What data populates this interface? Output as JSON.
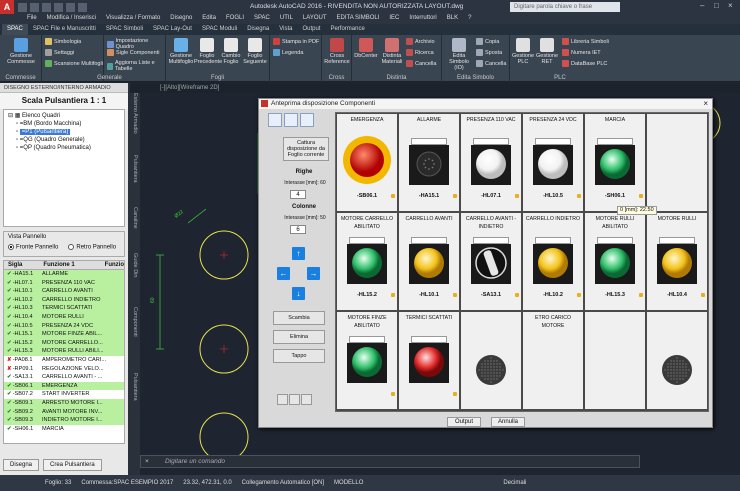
{
  "titlebar": {
    "logo": "A",
    "title": "Autodesk AutoCAD 2016 - RIVENDITA NON AUTORIZZATA   LAYOUT.dwg",
    "search": "Digitare parola chiave o frase"
  },
  "menu": [
    "File",
    "Modifica / Inserisci",
    "Visualizza / Formato",
    "Disegno",
    "Edita",
    "FOGLI",
    "SPAC",
    "UTIL",
    "LAYOUT",
    "EDITA SIMBOLI",
    "IEC",
    "Interruttori",
    "BLK",
    "?"
  ],
  "tabs": [
    "SPAC",
    "SPAC File e Manuscritti",
    "SPAC Simboli",
    "SPAC Lay-Out",
    "SPAC Moduli",
    "Disegna",
    "Vista",
    "Output",
    "Performance"
  ],
  "ribbon": {
    "groups": [
      "Commesse",
      "Generale",
      "Fogli",
      "Cross",
      "Distinta",
      "Edita Simbolo",
      "PLC"
    ],
    "buttons": {
      "gestione": "Gestione Commesse",
      "simbologia": "Simbologia",
      "settaggi": "Settaggi",
      "scansione": "Scansione Multifogli",
      "impostazione": "Impostazione Quadro",
      "sigle": "Sigle Componenti",
      "aggiorna": "Aggiorna Liste e Tabelle",
      "gestione_multi": "Gestione Multifoglio",
      "foglio_prec": "Foglio Precedente",
      "cambio": "Cambio Foglio",
      "foglio_succ": "Foglio Seguente",
      "stampa": "Stampa in PDF",
      "legenda": "Legenda",
      "cross": "Cross Reference",
      "dbcenter": "DbCenter",
      "distinta": "Distinta Materiali",
      "archivio": "Archivio",
      "ricerca": "Ricerca",
      "cancella_d": "Cancella",
      "edita_simbolo": "Edita Simbolo (IO)",
      "copia": "Copia",
      "sposta": "Sposta",
      "cancella": "Cancella",
      "gestione_plc": "Gestione PLC",
      "gestione_ret": "Gestione RET",
      "libreria": "Libreria Simboli",
      "numera": "Numera IET",
      "database": "DataBase PLC"
    }
  },
  "docbar": "[-][Alto][Wireframe 2D]",
  "leftpanel": {
    "header": "DISEGNO ESTERNO/INTERNO ARMADIO",
    "scale": "Scala Pulsantiera 1 : 1",
    "tree": [
      "Elenco Quadri",
      "=BM (Bordo Macchina)",
      "=P1 (Pulsantiera)",
      "=QG (Quadro Generale)",
      "=QP (Quadro Pneumatica)"
    ],
    "view_title": "Vista Pannello",
    "view_options": [
      "Fronte Pannello",
      "Retro Pannello"
    ],
    "list_headers": [
      "Sigla",
      "Funzione 1",
      "Funzio"
    ],
    "rows": [
      {
        "sigla": "-HA15.1",
        "funzione": "ALLARME",
        "ok": true,
        "green": true
      },
      {
        "sigla": "-HL07.1",
        "funzione": "PRESENZA 110 VAC",
        "ok": true,
        "green": true
      },
      {
        "sigla": "-HL10.1",
        "funzione": "CARRELLO AVANTI",
        "ok": true,
        "green": true
      },
      {
        "sigla": "-HL10.2",
        "funzione": "CARRELLO INDIETRO",
        "ok": true,
        "green": true
      },
      {
        "sigla": "-HL10.3",
        "funzione": "TERMICI SCATTATI",
        "ok": true,
        "green": true
      },
      {
        "sigla": "-HL10.4",
        "funzione": "MOTORE RULLI",
        "ok": true,
        "green": true
      },
      {
        "sigla": "-HL10.5",
        "funzione": "PRESENZA 24 VDC",
        "ok": true,
        "green": true
      },
      {
        "sigla": "-HL15.1",
        "funzione": "MOTORE FINZE ABIL...",
        "ok": true,
        "green": true
      },
      {
        "sigla": "-HL15.2",
        "funzione": "MOTORE CARRELLO...",
        "ok": true,
        "green": true
      },
      {
        "sigla": "-HL15.3",
        "funzione": "MOTORE RULLI ABILI...",
        "ok": true,
        "green": true
      },
      {
        "sigla": "-PA08.1",
        "funzione": "AMPEROMETRO CARI...",
        "ok": false,
        "green": false
      },
      {
        "sigla": "-RP09.1",
        "funzione": "REGOLAZIONE VELO...",
        "ok": false,
        "green": false
      },
      {
        "sigla": "-SA13.1",
        "funzione": "CARRELLO AVANTI - ...",
        "ok": true,
        "green": false
      },
      {
        "sigla": "-SB06.1",
        "funzione": "EMERGENZA",
        "ok": true,
        "green": true
      },
      {
        "sigla": "-SB07.2",
        "funzione": "START INVERTER",
        "ok": true,
        "green": false
      },
      {
        "sigla": "-SB09.1",
        "funzione": "ARRESTO MOTORE I...",
        "ok": true,
        "green": true
      },
      {
        "sigla": "-SB09.2",
        "funzione": "AVANTI MOTORE INV...",
        "ok": true,
        "green": true
      },
      {
        "sigla": "-SB09.3",
        "funzione": "INDIETRO MOTORE I...",
        "ok": true,
        "green": true
      },
      {
        "sigla": "-SH06.1",
        "funzione": "MARCIA",
        "ok": true,
        "green": false
      }
    ],
    "buttons": [
      "Disegna",
      "Crea Pulsantiera"
    ]
  },
  "vtabs": [
    "Esterno Armadio",
    "Pulsantiera",
    "Canaline",
    "Guide Din",
    "Componenti",
    "Pulsantiera"
  ],
  "dialog": {
    "title": "Anteprima disposizione Componenti",
    "cattura": "Cattura disposizione da Foglio corrente",
    "righe": "Righe",
    "righe_int": "Interasse [mm]: 60",
    "righe_val": "4",
    "colonne": "Colonne",
    "colonne_int": "Interasse [mm]: 50",
    "colonne_val": "6",
    "scambia": "Scambia",
    "elimina": "Elimina",
    "tappo": "Tappo",
    "output": "Output",
    "annulla": "Annulla",
    "tooltip": "0 [mm]: 22.50",
    "cells": [
      {
        "title": "EMERGENZA",
        "code": "-SB06.1",
        "kind": "emerg"
      },
      {
        "title": "ALLARME",
        "code": "-HA15.1",
        "kind": "buzzer"
      },
      {
        "title": "PRESENZA 110 VAC",
        "code": "-HL07.1",
        "kind": "white"
      },
      {
        "title": "PRESENZA 24 VDC",
        "code": "-HL10.5",
        "kind": "white"
      },
      {
        "title": "MARCIA",
        "code": "-SH06.1",
        "kind": "green"
      },
      {
        "title": "",
        "code": "",
        "kind": "empty"
      },
      {
        "title": "MOTORE CARRELLO ABILITATO",
        "code": "-HL15.2",
        "kind": "green"
      },
      {
        "title": "CARRELLO AVANTI",
        "code": "-HL10.1",
        "kind": "yellow"
      },
      {
        "title": "CARRELLO AVANTI - INDIETRO",
        "code": "-SA13.1",
        "kind": "selector"
      },
      {
        "title": "CARRELLO INDIETRO",
        "code": "-HL10.2",
        "kind": "yellow"
      },
      {
        "title": "MOTORE RULLI ABILITATO",
        "code": "-HL15.3",
        "kind": "green"
      },
      {
        "title": "MOTORE RULLI",
        "code": "-HL10.4",
        "kind": "yellow"
      },
      {
        "title": "MOTORE FINZE ABILITATO",
        "code": "",
        "kind": "green"
      },
      {
        "title": "TERMICI SCATTATI",
        "code": "",
        "kind": "red"
      },
      {
        "title": "",
        "code": "",
        "kind": "dark"
      },
      {
        "title": "ETRO CARICO MOTORE",
        "code": "",
        "kind": "empty"
      },
      {
        "title": "",
        "code": "",
        "kind": "empty"
      },
      {
        "title": "",
        "code": "",
        "kind": "dark"
      }
    ]
  },
  "cmdline": "Digitare un comando",
  "status": {
    "foglio": "Foglio: 33",
    "commessa": "Commessa:SPAC ESEMPIO 2017",
    "coords": "23.32, 472.31, 0.0",
    "collegamento": "Collegamento Automatico [ON]",
    "modello": "MODELLO",
    "decimali": "Decimali"
  }
}
